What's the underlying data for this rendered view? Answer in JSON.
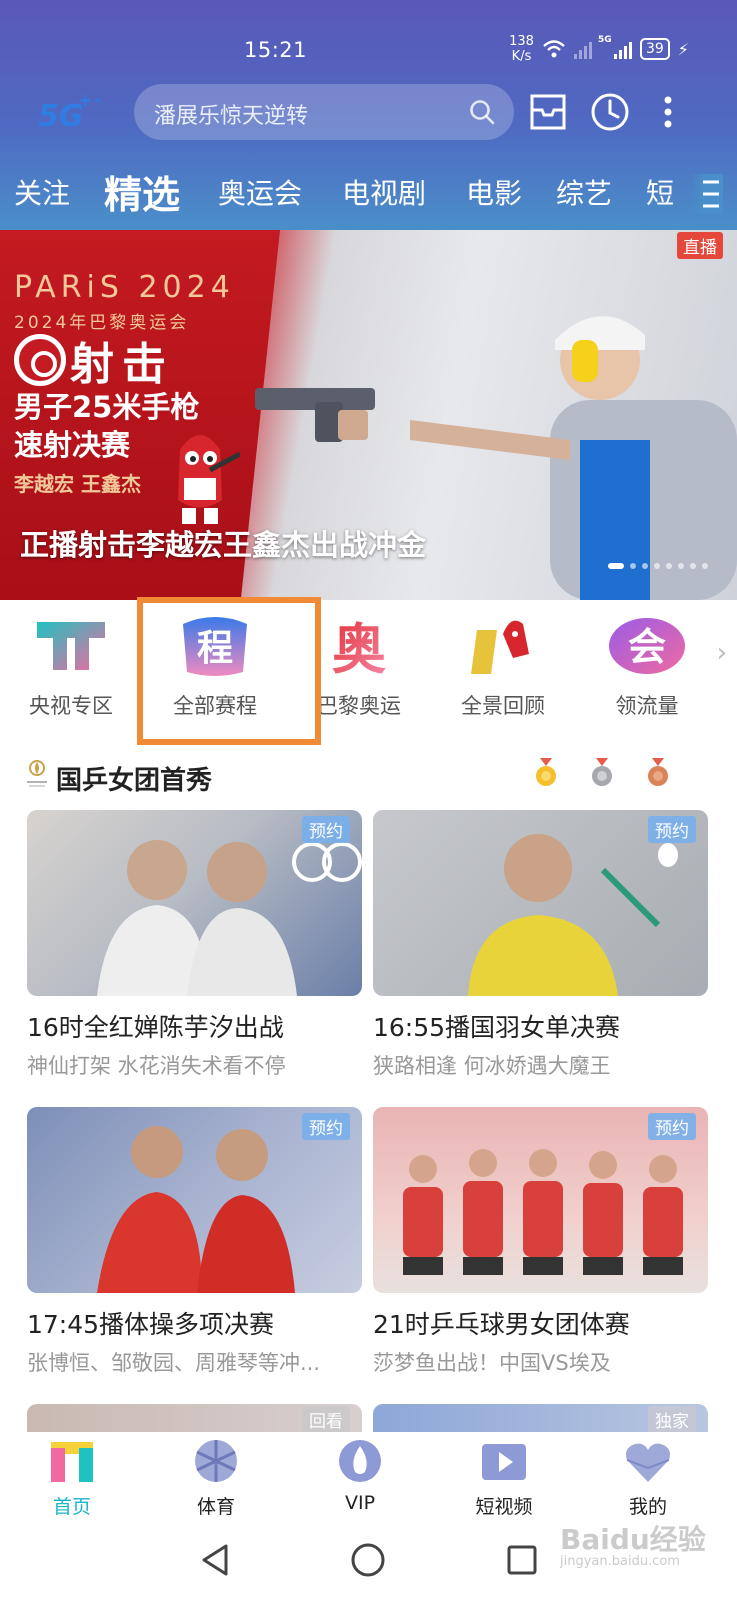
{
  "status_bar": {
    "time": "15:21",
    "net_speed_value": "138",
    "net_speed_unit": "K/s",
    "battery": "39"
  },
  "search": {
    "placeholder": "潘展乐惊天逆转"
  },
  "tabs": [
    "关注",
    "精选",
    "奥运会",
    "电视剧",
    "电影",
    "综艺",
    "短"
  ],
  "active_tab": "精选",
  "hero": {
    "live_badge": "直播",
    "paris": "PARiS 2024",
    "paris_sub": "2024年巴黎奥运会",
    "sport": "射击",
    "event_line1": "男子25米手枪",
    "event_line2": "速射决赛",
    "athletes": "李越宏 王鑫杰",
    "caption": "正播射击李越宏王鑫杰出战冲金",
    "dots_total": 8,
    "dots_active": 0
  },
  "entries": [
    {
      "label": "央视专区",
      "icon": "cctv-zone-icon"
    },
    {
      "label": "全部赛程",
      "icon": "schedule-icon"
    },
    {
      "label": "巴黎奥运",
      "icon": "paris-olympics-icon"
    },
    {
      "label": "全景回顾",
      "icon": "review-icon"
    },
    {
      "label": "领流量",
      "icon": "data-icon"
    }
  ],
  "section": {
    "title": "国乒女团首秀"
  },
  "cards": [
    {
      "badge": "预约",
      "title": "16时全红婵陈芋汐出战",
      "subtitle": "神仙打架 水花消失术看不停"
    },
    {
      "badge": "预约",
      "title": "16:55播国羽女单决赛",
      "subtitle": "狭路相逢 何冰娇遇大魔王"
    },
    {
      "badge": "预约",
      "title": "17:45播体操多项决赛",
      "subtitle": "张博恒、邹敬园、周雅琴等冲..."
    },
    {
      "badge": "预约",
      "title": "21时乒乓球男女团体赛",
      "subtitle": "莎梦鱼出战！中国VS埃及"
    }
  ],
  "partial_cards": [
    {
      "badge": "回看"
    },
    {
      "badge": "独家"
    }
  ],
  "bottom_nav": [
    {
      "label": "首页",
      "icon": "home-icon",
      "active": true
    },
    {
      "label": "体育",
      "icon": "sports-icon",
      "active": false
    },
    {
      "label": "VIP",
      "icon": "vip-icon",
      "active": false
    },
    {
      "label": "短视频",
      "icon": "short-video-icon",
      "active": false
    },
    {
      "label": "我的",
      "icon": "profile-icon",
      "active": false
    }
  ],
  "watermark": {
    "text": "Baidu经验",
    "sub": "jingyan.baidu.com"
  },
  "colors": {
    "accent": "#19b6c8",
    "highlight": "#f08a35",
    "header_top": "#5a58b8",
    "header_bottom": "#4a8fc9"
  }
}
